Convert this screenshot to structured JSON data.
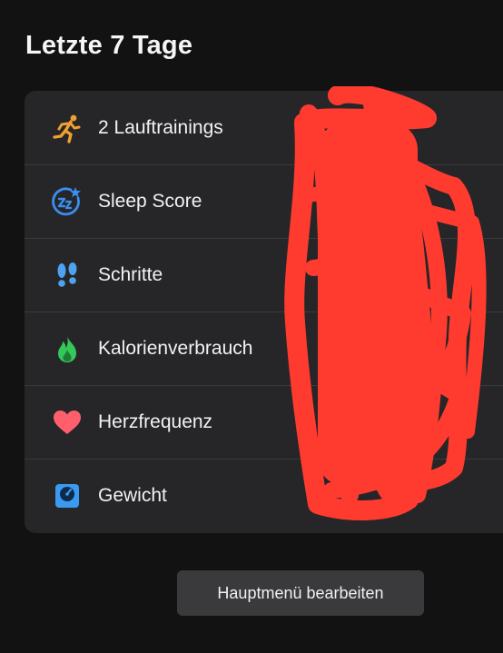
{
  "header": {
    "title": "Letzte 7 Tage"
  },
  "rows": [
    {
      "label": "2 Lauftrainings",
      "icon": "running-icon",
      "color": "#f0a030"
    },
    {
      "label": "Sleep Score",
      "icon": "sleep-icon",
      "color": "#3a8ef0"
    },
    {
      "label": "Schritte",
      "icon": "footprints-icon",
      "color": "#4ea3f0"
    },
    {
      "label": "Kalorienverbrauch",
      "icon": "flame-icon",
      "color": "#34c759"
    },
    {
      "label": "Herzfrequenz",
      "icon": "heart-icon",
      "color": "#ff5f6d"
    },
    {
      "label": "Gewicht",
      "icon": "scale-icon",
      "color": "#3a9af0"
    }
  ],
  "redaction_color": "#ff3b30",
  "footer": {
    "button_label": "Hauptmenü bearbeiten"
  }
}
